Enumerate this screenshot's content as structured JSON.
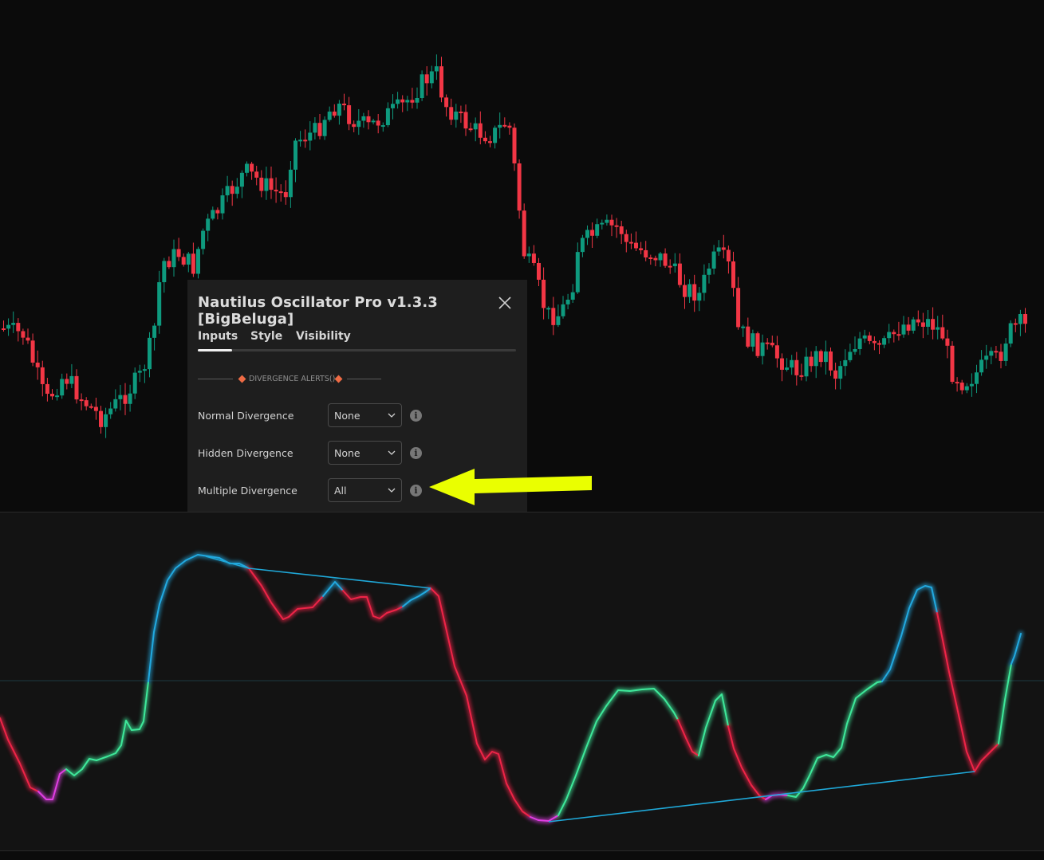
{
  "dialog": {
    "title": "Nautilus Oscillator Pro v1.3.3 [BigBeluga]",
    "tabs": [
      "Inputs",
      "Style",
      "Visibility"
    ],
    "active_tab": "Inputs",
    "section_title": "DIVERGENCE ALERTS()",
    "rows": [
      {
        "label": "Normal Divergence",
        "value": "None"
      },
      {
        "label": "Hidden Divergence",
        "value": "None"
      },
      {
        "label": "Multiple Divergence",
        "value": "All"
      }
    ]
  },
  "colors": {
    "bull_candle": "#0e9a7e",
    "bear_candle": "#f23645",
    "osc_red": "#ee2447",
    "osc_green": "#3ee89a",
    "osc_blue": "#22a9e0",
    "osc_magenta": "#e03ee3",
    "divergence_line": "#1fa8d8",
    "highlight_arrow": "#eaff00"
  },
  "icons": {
    "close": "close-icon",
    "dropdown": "chevron-down-icon",
    "info": "info-icon",
    "annotation": "arrow-left-icon"
  }
}
